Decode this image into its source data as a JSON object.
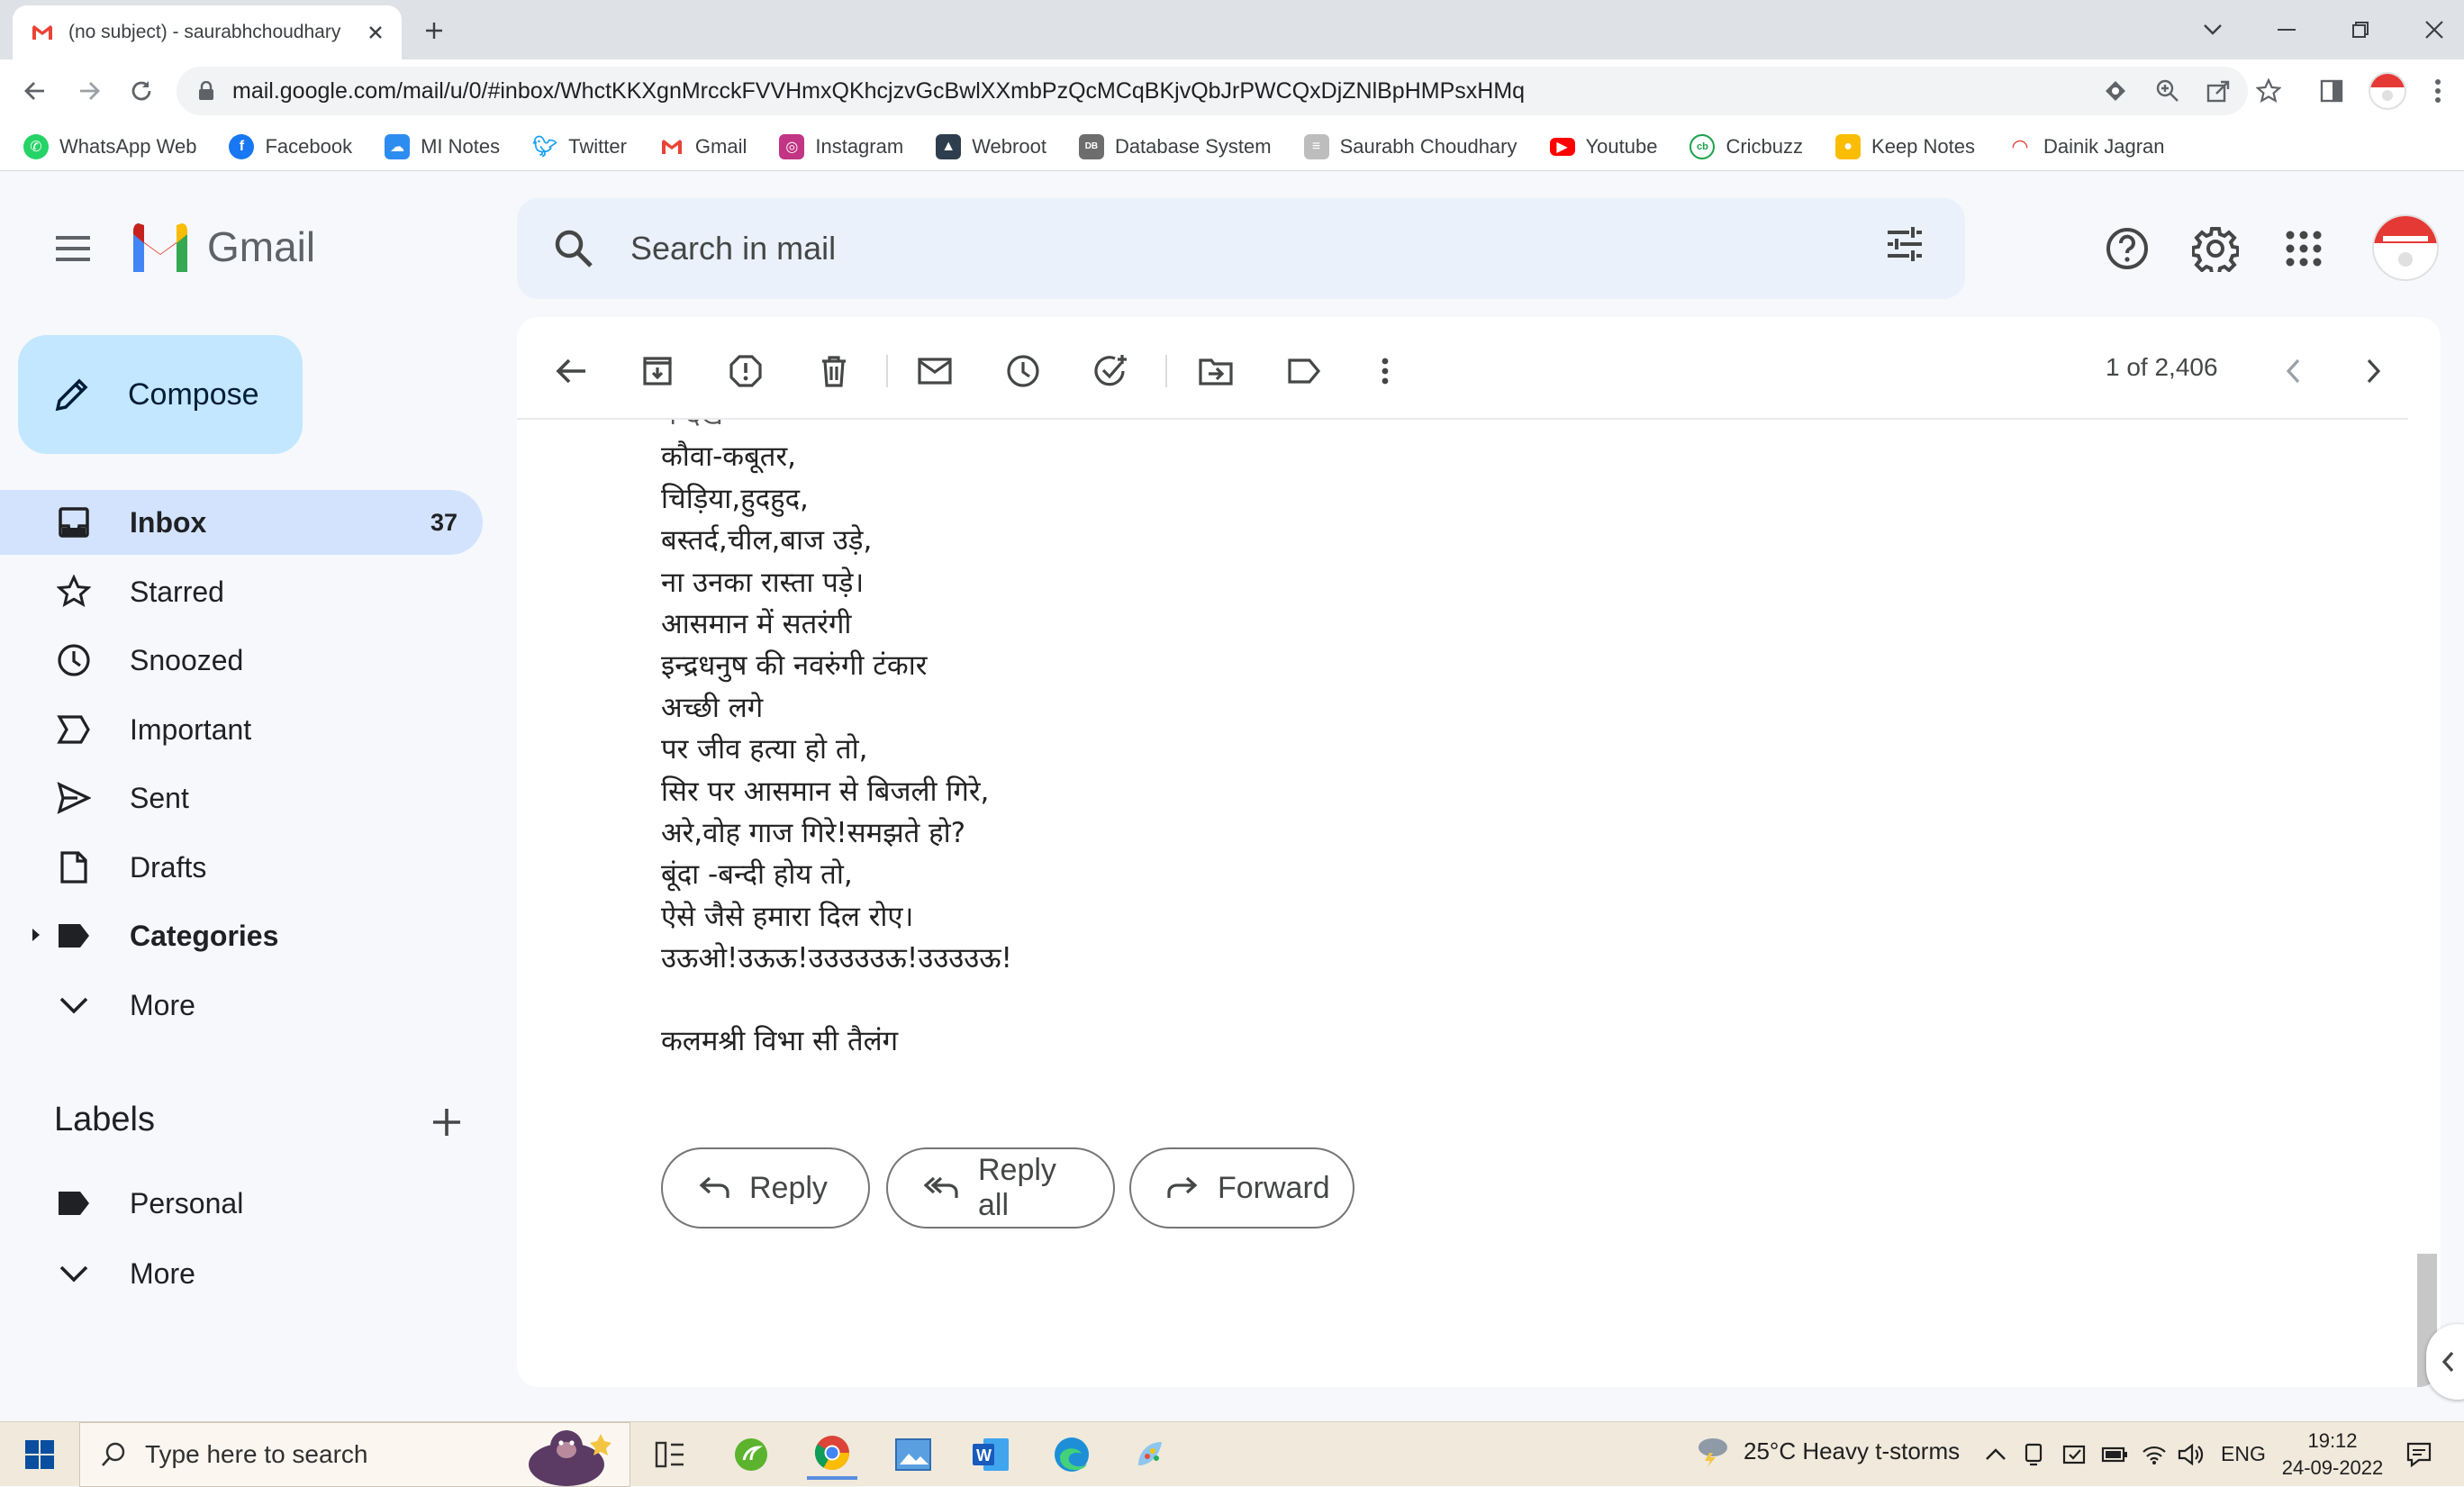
{
  "browser": {
    "tab_title": "(no subject) - saurabhchoudhary",
    "url": "mail.google.com/mail/u/0/#inbox/WhctKKXgnMrcckFVVHmxQKhcjzvGcBwlXXmbPzQcMCqBKjvQbJrPWCQxDjZNlBpHMPsxHMq",
    "bookmarks": [
      {
        "label": "WhatsApp Web",
        "icon": "whatsapp-icon",
        "color": "#25d366"
      },
      {
        "label": "Facebook",
        "icon": "facebook-icon",
        "color": "#1877f2"
      },
      {
        "label": "MI Notes",
        "icon": "cloud-icon",
        "color": "#2d8cf0"
      },
      {
        "label": "Twitter",
        "icon": "twitter-icon",
        "color": "#1da1f2"
      },
      {
        "label": "Gmail",
        "icon": "gmail-icon",
        "color": "#ea4335"
      },
      {
        "label": "Instagram",
        "icon": "instagram-icon",
        "color": "#c13584"
      },
      {
        "label": "Webroot",
        "icon": "webroot-icon",
        "color": "#2f3e4e"
      },
      {
        "label": "Database System",
        "icon": "database-icon",
        "color": "#6d6d6d"
      },
      {
        "label": "Saurabh Choudhary",
        "icon": "page-icon",
        "color": "#9e9e9e"
      },
      {
        "label": "Youtube",
        "icon": "youtube-icon",
        "color": "#ff0000"
      },
      {
        "label": "Cricbuzz",
        "icon": "cricbuzz-icon",
        "color": "#1aa14a"
      },
      {
        "label": "Keep Notes",
        "icon": "keep-icon",
        "color": "#fbbc04"
      },
      {
        "label": "Dainik Jagran",
        "icon": "jagran-icon",
        "color": "#e53935"
      }
    ]
  },
  "gmail": {
    "brand": "Gmail",
    "search_placeholder": "Search in mail",
    "compose": "Compose",
    "nav": [
      {
        "label": "Inbox",
        "count": "37",
        "icon": "inbox-icon"
      },
      {
        "label": "Starred",
        "count": "",
        "icon": "star-icon"
      },
      {
        "label": "Snoozed",
        "count": "",
        "icon": "clock-icon"
      },
      {
        "label": "Important",
        "count": "",
        "icon": "important-icon"
      },
      {
        "label": "Sent",
        "count": "",
        "icon": "send-icon"
      },
      {
        "label": "Drafts",
        "count": "",
        "icon": "draft-icon"
      },
      {
        "label": "Categories",
        "count": "",
        "icon": "label-icon"
      },
      {
        "label": "More",
        "count": "",
        "icon": "chevron-down-icon"
      }
    ],
    "labels_title": "Labels",
    "labels": [
      {
        "label": "Personal",
        "icon": "label-icon"
      },
      {
        "label": "More",
        "icon": "chevron-down-icon"
      }
    ],
    "pager": "1 of 2,406",
    "body_lines": [
      "न देख",
      "कौवा-कबूतर,",
      "चिड़िया,हुदहुद,",
      "बस्तर्द,चील,बाज उड़े,",
      "ना उनका रास्ता पड़े।",
      "आसमान में सतरंगी",
      "इन्द्रधनुष की नवरुंगी टंकार",
      "अच्छी लगे",
      "पर जीव हत्या हो तो,",
      "सिर पर आसमान से बिजली गिरे,",
      "अरे,वोह गाज गिरे!समझते हो?",
      "बूंदा -बन्दी होय तो,",
      "ऐसे जैसे हमारा दिल रोए।",
      "उऊओ!उऊऊ!उउउउउऊ!उउउउऊ!"
    ],
    "signature": "कलमश्री विभा सी तैलंग",
    "reply": "Reply",
    "reply_all": "Reply all",
    "forward": "Forward"
  },
  "taskbar": {
    "search_placeholder": "Type here to search",
    "weather": "25°C  Heavy t-storms",
    "lang": "ENG",
    "time": "19:12",
    "date": "24-09-2022"
  }
}
